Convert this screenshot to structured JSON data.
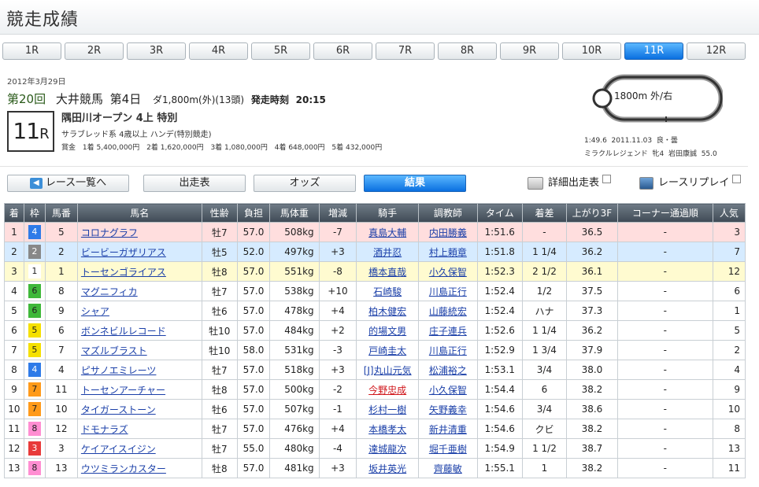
{
  "page": {
    "title": "競走成績"
  },
  "race_tabs": [
    "1R",
    "2R",
    "3R",
    "4R",
    "5R",
    "6R",
    "7R",
    "8R",
    "9R",
    "10R",
    "11R",
    "12R"
  ],
  "active_race": "11R",
  "race": {
    "date": "2012年3月29日",
    "kai": "第20回",
    "venue": "大井競馬",
    "day": "第4日",
    "cond": "ダ1,800m(外)(13頭)",
    "start_label": "発走時刻",
    "start_time": "20:15",
    "race_no": "11",
    "race_no_suffix": "R",
    "name": "隅田川オープン 4上  特別",
    "type": "サラブレッド系  4歳以上  ハンデ(特別競走)",
    "prize_label": "賞金",
    "prizes": [
      "1着 5,400,000円",
      "2着 1,620,000円",
      "3着 1,080,000円",
      "4着 648,000円",
      "5着 432,000円"
    ]
  },
  "course": {
    "label": "1800m  外/右",
    "record_time": "1:49.6",
    "record_date": "2011.11.03",
    "record_cond": "良・曇",
    "record_horse": "ミラクルレジェンド",
    "record_sexage": "牝4",
    "record_jockey": "岩田康誠",
    "record_weight": "55.0"
  },
  "nav": {
    "back": "レース一覧へ",
    "entries": "出走表",
    "odds": "オッズ",
    "results": "結果",
    "detail": "詳細出走表",
    "replay": "レースリプレイ"
  },
  "table": {
    "headers": [
      "着",
      "枠",
      "馬番",
      "馬名",
      "性齢",
      "負担",
      "馬体重",
      "増減",
      "騎手",
      "調教師",
      "タイム",
      "着差",
      "上がり3F",
      "コーナー通過順",
      "人気"
    ],
    "rows": [
      {
        "pos": "1",
        "waku": "4",
        "num": "5",
        "horse": "コロナグラフ",
        "sexage": "牡7",
        "weight": "57.0",
        "body": "508kg",
        "diff": "-7",
        "jockey": "真島大輔",
        "trainer": "内田勝義",
        "time": "1:51.6",
        "margin": "-",
        "last3f": "36.5",
        "corner": "-",
        "pop": "3"
      },
      {
        "pos": "2",
        "waku": "2",
        "num": "2",
        "horse": "ビービーガザリアス",
        "sexage": "牡5",
        "weight": "52.0",
        "body": "497kg",
        "diff": "+3",
        "jockey": "酒井忍",
        "trainer": "村上頼章",
        "time": "1:51.8",
        "margin": "1 1/4",
        "last3f": "36.2",
        "corner": "-",
        "pop": "7"
      },
      {
        "pos": "3",
        "waku": "1",
        "num": "1",
        "horse": "トーセンゴライアス",
        "sexage": "牡8",
        "weight": "57.0",
        "body": "551kg",
        "diff": "-8",
        "jockey": "橋本直哉",
        "trainer": "小久保智",
        "time": "1:52.3",
        "margin": "2 1/2",
        "last3f": "36.1",
        "corner": "-",
        "pop": "12"
      },
      {
        "pos": "4",
        "waku": "6",
        "num": "8",
        "horse": "マグニフィカ",
        "sexage": "牡7",
        "weight": "57.0",
        "body": "538kg",
        "diff": "+10",
        "jockey": "石崎駿",
        "trainer": "川島正行",
        "time": "1:52.4",
        "margin": "1/2",
        "last3f": "37.5",
        "corner": "-",
        "pop": "6"
      },
      {
        "pos": "5",
        "waku": "6",
        "num": "9",
        "horse": "シャア",
        "sexage": "牡6",
        "weight": "57.0",
        "body": "478kg",
        "diff": "+4",
        "jockey": "柏木健宏",
        "trainer": "山藤統宏",
        "time": "1:52.4",
        "margin": "ハナ",
        "last3f": "37.3",
        "corner": "-",
        "pop": "1"
      },
      {
        "pos": "6",
        "waku": "5",
        "num": "6",
        "horse": "ボンネビルレコード",
        "sexage": "牡10",
        "weight": "57.0",
        "body": "484kg",
        "diff": "+2",
        "jockey": "的場文男",
        "trainer": "庄子連兵",
        "time": "1:52.6",
        "margin": "1 1/4",
        "last3f": "36.2",
        "corner": "-",
        "pop": "5"
      },
      {
        "pos": "7",
        "waku": "5",
        "num": "7",
        "horse": "マズルブラスト",
        "sexage": "牡10",
        "weight": "58.0",
        "body": "531kg",
        "diff": "-3",
        "jockey": "戸崎圭太",
        "trainer": "川島正行",
        "time": "1:52.9",
        "margin": "1 3/4",
        "last3f": "37.9",
        "corner": "-",
        "pop": "2"
      },
      {
        "pos": "8",
        "waku": "4",
        "num": "4",
        "horse": "ピサノエミレーツ",
        "sexage": "牡7",
        "weight": "57.0",
        "body": "518kg",
        "diff": "+3",
        "jockey": "[J]丸山元気",
        "trainer": "松浦裕之",
        "time": "1:53.1",
        "margin": "3/4",
        "last3f": "38.0",
        "corner": "-",
        "pop": "4"
      },
      {
        "pos": "9",
        "waku": "7",
        "num": "11",
        "horse": "トーセンアーチャー",
        "sexage": "牡8",
        "weight": "57.0",
        "body": "500kg",
        "diff": "-2",
        "jockey": "今野忠成",
        "trainer": "小久保智",
        "time": "1:54.4",
        "margin": "6",
        "last3f": "38.2",
        "corner": "-",
        "pop": "9",
        "jockey_red": true
      },
      {
        "pos": "10",
        "waku": "7",
        "num": "10",
        "horse": "タイガーストーン",
        "sexage": "牡6",
        "weight": "57.0",
        "body": "507kg",
        "diff": "-1",
        "jockey": "杉村一樹",
        "trainer": "矢野義幸",
        "time": "1:54.6",
        "margin": "3/4",
        "last3f": "38.6",
        "corner": "-",
        "pop": "10"
      },
      {
        "pos": "11",
        "waku": "8",
        "num": "12",
        "horse": "ドモナラズ",
        "sexage": "牡7",
        "weight": "57.0",
        "body": "476kg",
        "diff": "+4",
        "jockey": "本橋孝太",
        "trainer": "新井清重",
        "time": "1:54.6",
        "margin": "クビ",
        "last3f": "38.2",
        "corner": "-",
        "pop": "8"
      },
      {
        "pos": "12",
        "waku": "3",
        "num": "3",
        "horse": "ケイアイスイジン",
        "sexage": "牡7",
        "weight": "55.0",
        "body": "480kg",
        "diff": "-4",
        "jockey": "達城龍次",
        "trainer": "堀千亜樹",
        "time": "1:54.9",
        "margin": "1 1/2",
        "last3f": "38.7",
        "corner": "-",
        "pop": "13"
      },
      {
        "pos": "13",
        "waku": "8",
        "num": "13",
        "horse": "ウツミランカスター",
        "sexage": "牡8",
        "weight": "57.0",
        "body": "481kg",
        "diff": "+3",
        "jockey": "坂井英光",
        "trainer": "齊藤敏",
        "time": "1:55.1",
        "margin": "1",
        "last3f": "38.2",
        "corner": "-",
        "pop": "11"
      }
    ]
  },
  "waku_colors": {
    "1": [
      "#ffffff",
      "#222222"
    ],
    "2": [
      "#888888",
      "#ffffff"
    ],
    "3": [
      "#e83a3a",
      "#ffffff"
    ],
    "4": [
      "#2f7be8",
      "#ffffff"
    ],
    "5": [
      "#f5e000",
      "#222222"
    ],
    "6": [
      "#3fb83a",
      "#222222"
    ],
    "7": [
      "#ff9a1a",
      "#222222"
    ],
    "8": [
      "#ff8ed2",
      "#222222"
    ]
  },
  "icons": {
    "back": "left-arrow-icon",
    "detail": "book-icon",
    "replay": "video-icon",
    "external": "external-window-icon"
  }
}
